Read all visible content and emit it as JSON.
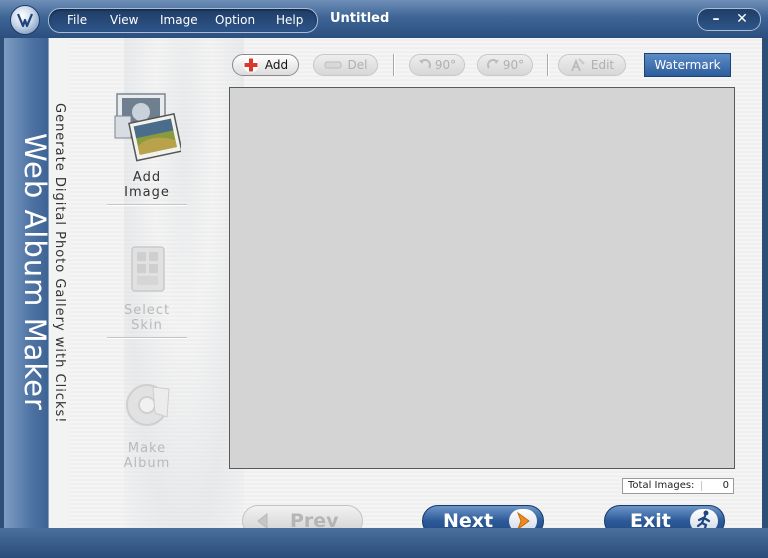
{
  "window": {
    "title": "Untitled",
    "minimize_glyph": "–",
    "close_glyph": "✕"
  },
  "menu": {
    "items": [
      {
        "label": "File"
      },
      {
        "label": "View"
      },
      {
        "label": "Image"
      },
      {
        "label": "Option"
      },
      {
        "label": "Help"
      }
    ]
  },
  "side": {
    "app_name": "Web Album Maker",
    "tagline": "Generate Digital Photo Gallery with Clicks!"
  },
  "tools": [
    {
      "label": "Add Image",
      "enabled": true,
      "icon": "photo-stack-icon"
    },
    {
      "label": "Select Skin",
      "enabled": false,
      "icon": "skin-icon"
    },
    {
      "label": "Make Album",
      "enabled": false,
      "icon": "album-icon"
    }
  ],
  "toolbar": {
    "add_label": "Add",
    "del_label": "Del",
    "rotate_left_label": "90°",
    "rotate_right_label": "90°",
    "edit_label": "Edit",
    "watermark_label": "Watermark"
  },
  "status": {
    "total_label": "Total Images:",
    "total_value": "0"
  },
  "nav": {
    "prev_label": "Prev",
    "next_label": "Next",
    "exit_label": "Exit"
  },
  "colors": {
    "accent": "#2c5a98",
    "add_red": "#d9382a",
    "next_orange": "#f08a1c"
  }
}
